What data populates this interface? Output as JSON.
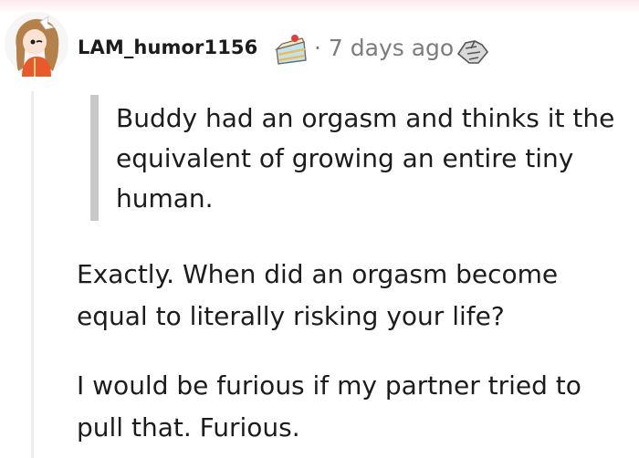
{
  "comment": {
    "username": "LAM_humor1156",
    "separator": "·",
    "timestamp": "7 days ago",
    "quote": "Buddy had an orgasm and thinks it the equivalent of growing an entire tiny human.",
    "paragraphs": [
      "Exactly. When did an orgasm become equal to literally risking your life?",
      "I would be furious if my partner tried to pull that. Furious."
    ]
  },
  "icons": {
    "avatar": "avatar",
    "flair": "cake-icon",
    "award": "handshake-award-icon"
  },
  "colors": {
    "text": "#1c1c1c",
    "meta": "#7c7c7c",
    "quote_bar": "#c8c8c8",
    "thread_line": "#ededed"
  }
}
